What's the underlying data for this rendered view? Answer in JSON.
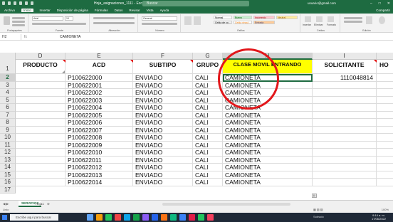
{
  "app": {
    "file_name": "Hoja_asignaciones_1111 - Excel",
    "search_placeholder": "Buscar",
    "user_email": "usuario@gmail.com",
    "share_label": "Compartir",
    "colors": {
      "accent": "#1e6b41",
      "header_highlight": "#ffff00",
      "circle": "#e2171b"
    }
  },
  "menu": {
    "tabs": [
      "Archivo",
      "Inicio",
      "Insertar",
      "Disposición de página",
      "Fórmulas",
      "Datos",
      "Revisar",
      "Vista",
      "Ayuda"
    ],
    "active_tab": "Inicio"
  },
  "ribbon": {
    "groups": [
      "Portapapeles",
      "Fuente",
      "Alineación",
      "Número",
      "Estilos",
      "Celdas",
      "Edición"
    ],
    "font_name": "Arial",
    "font_size": "10",
    "number_format": "General",
    "styles": [
      "Normal",
      "Bueno",
      "Incorrecto",
      "Neutral",
      "Celda de co...",
      "Celda vincul...",
      "Entrada"
    ],
    "cells_buttons": [
      "Insertar",
      "Eliminar",
      "Formato"
    ]
  },
  "formula_bar": {
    "name_box": "H2",
    "fx": "fx",
    "content": "CAMIONETA"
  },
  "columns": [
    {
      "letter": "D",
      "header": "PRODUCTO"
    },
    {
      "letter": "E",
      "header": "ACD"
    },
    {
      "letter": "F",
      "header": "SUBTIPO"
    },
    {
      "letter": "G",
      "header": "GRUPO"
    },
    {
      "letter": "H",
      "header": "CLASE MOVIL ENTRANDO"
    },
    {
      "letter": "I",
      "header": "SOLICITANTE"
    },
    {
      "letter": "J",
      "header": "HO"
    }
  ],
  "selected_column": "H",
  "rows": [
    {
      "n": "2",
      "acd": "P100622000",
      "subtipo": "ENVIADO",
      "grupo": "CALI",
      "clase": "CAMIONETA",
      "solicitante": "1110048814"
    },
    {
      "n": "3",
      "acd": "P100622001",
      "subtipo": "ENVIADO",
      "grupo": "CALI",
      "clase": "CAMIONETA",
      "solicitante": ""
    },
    {
      "n": "4",
      "acd": "P100622002",
      "subtipo": "ENVIADO",
      "grupo": "CALI",
      "clase": "CAMIONETA",
      "solicitante": ""
    },
    {
      "n": "5",
      "acd": "P100622003",
      "subtipo": "ENVIADO",
      "grupo": "CALI",
      "clase": "CAMIONETA",
      "solicitante": ""
    },
    {
      "n": "6",
      "acd": "P100622004",
      "subtipo": "ENVIADO",
      "grupo": "CALI",
      "clase": "CAMIONETA",
      "solicitante": ""
    },
    {
      "n": "7",
      "acd": "P100622005",
      "subtipo": "ENVIADO",
      "grupo": "CALI",
      "clase": "CAMIONETA",
      "solicitante": ""
    },
    {
      "n": "8",
      "acd": "P100622006",
      "subtipo": "ENVIADO",
      "grupo": "CALI",
      "clase": "CAMIONETA",
      "solicitante": ""
    },
    {
      "n": "9",
      "acd": "P100622007",
      "subtipo": "ENVIADO",
      "grupo": "CALI",
      "clase": "CAMIONETA",
      "solicitante": ""
    },
    {
      "n": "10",
      "acd": "P100622008",
      "subtipo": "ENVIADO",
      "grupo": "CALI",
      "clase": "CAMIONETA",
      "solicitante": ""
    },
    {
      "n": "11",
      "acd": "P100622009",
      "subtipo": "ENVIADO",
      "grupo": "CALI",
      "clase": "CAMIONETA",
      "solicitante": ""
    },
    {
      "n": "12",
      "acd": "P100622010",
      "subtipo": "ENVIADO",
      "grupo": "CALI",
      "clase": "CAMIONETA",
      "solicitante": ""
    },
    {
      "n": "13",
      "acd": "P100622011",
      "subtipo": "ENVIADO",
      "grupo": "CALI",
      "clase": "CAMIONETA",
      "solicitante": ""
    },
    {
      "n": "14",
      "acd": "P100622012",
      "subtipo": "ENVIADO",
      "grupo": "CALI",
      "clase": "CAMIONETA",
      "solicitante": ""
    },
    {
      "n": "15",
      "acd": "P100622013",
      "subtipo": "ENVIADO",
      "grupo": "CALI",
      "clase": "CAMIONETA",
      "solicitante": ""
    },
    {
      "n": "16",
      "acd": "P100622014",
      "subtipo": "ENVIADO",
      "grupo": "CALI",
      "clase": "CAMIONETA",
      "solicitante": ""
    }
  ],
  "header_row_number": "1",
  "partial_row_number": "17",
  "sheets": {
    "tabs": [
      "SERVICIOS",
      "Hoja1"
    ],
    "active": "SERVICIOS",
    "add_icon": "plus-icon"
  },
  "status": {
    "ready": "Listo",
    "zoom": "100%"
  },
  "taskbar": {
    "search_placeholder": "Escribe aquí para buscar",
    "tray_text": "Soleado",
    "time": "9:14 a. m.",
    "date": "17/06/2022"
  }
}
